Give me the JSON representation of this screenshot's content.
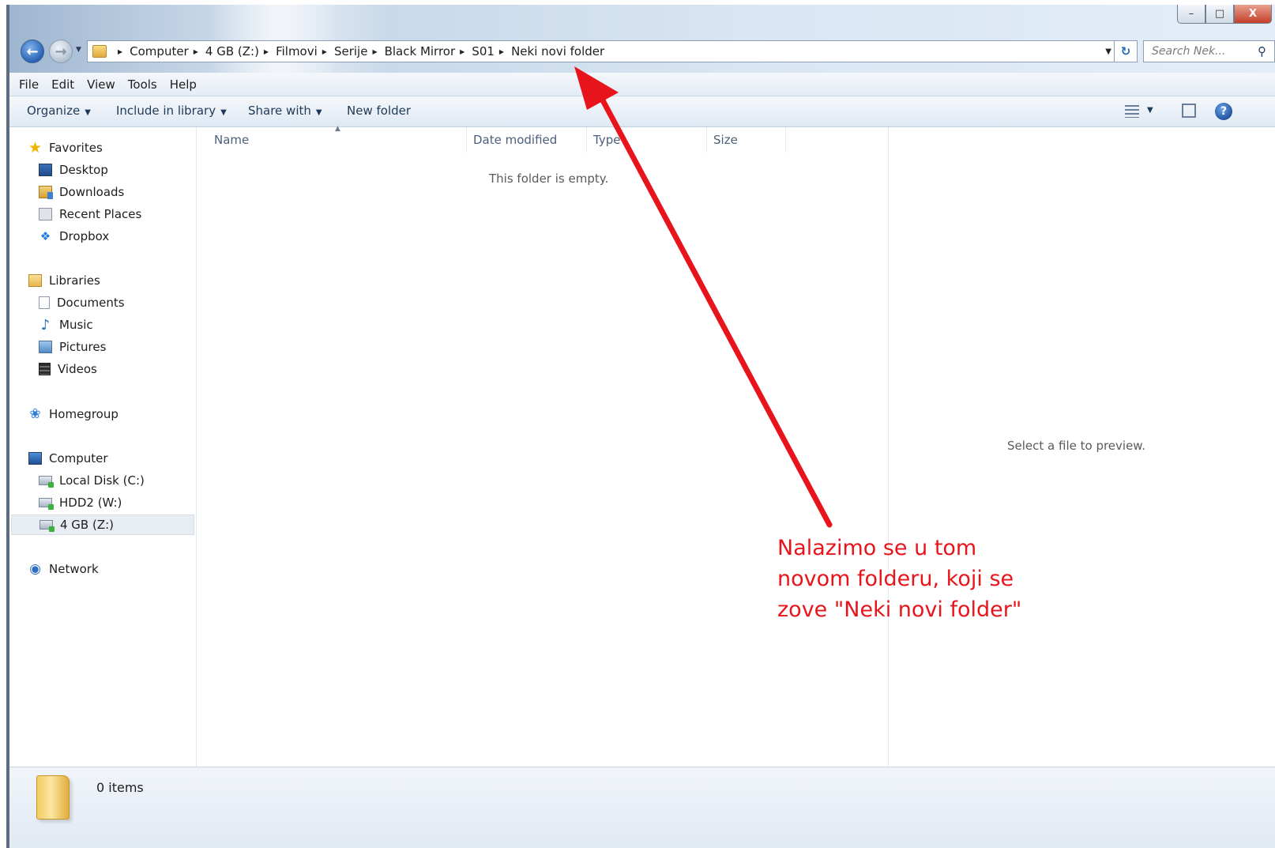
{
  "window": {
    "controls": {
      "minimize": "–",
      "maximize": "□",
      "close": "X"
    }
  },
  "address_bar": {
    "breadcrumbs": [
      "Computer",
      "4 GB  (Z:)",
      "Filmovi",
      "Serije",
      "Black Mirror",
      "S01",
      "Neki novi folder"
    ]
  },
  "search": {
    "placeholder": "Search Nek..."
  },
  "menu": {
    "items": [
      "File",
      "Edit",
      "View",
      "Tools",
      "Help"
    ]
  },
  "toolbar": {
    "organize": "Organize",
    "include_in_library": "Include in library",
    "share_with": "Share with",
    "new_folder": "New folder"
  },
  "nav": {
    "favorites": {
      "label": "Favorites",
      "items": [
        "Desktop",
        "Downloads",
        "Recent Places",
        "Dropbox"
      ]
    },
    "libraries": {
      "label": "Libraries",
      "items": [
        "Documents",
        "Music",
        "Pictures",
        "Videos"
      ]
    },
    "homegroup": {
      "label": "Homegroup"
    },
    "computer": {
      "label": "Computer",
      "items": [
        "Local Disk (C:)",
        "HDD2 (W:)",
        "4 GB  (Z:)"
      ]
    },
    "network": {
      "label": "Network"
    }
  },
  "file_list": {
    "columns": [
      "Name",
      "Date modified",
      "Type",
      "Size"
    ],
    "empty_message": "This folder is empty."
  },
  "preview": {
    "message": "Select a file to preview."
  },
  "details": {
    "item_count": "0 items"
  },
  "annotation": {
    "lines": [
      "Nalazimo se u tom",
      "novom folderu, koji se",
      "zove \"Neki novi folder\""
    ],
    "color": "#e8141b"
  }
}
